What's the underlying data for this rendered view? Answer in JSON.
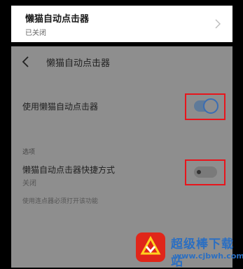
{
  "top_card": {
    "title": "懒猫自动点击器",
    "status": "已关闭",
    "chevron_icon": "chevron-right-icon"
  },
  "panel": {
    "back_icon": "back-arrow-icon",
    "title": "懒猫自动点击器",
    "row_enable": {
      "label": "使用懒猫自动点击器",
      "enabled": true
    },
    "section_label": "选项",
    "row_shortcut": {
      "label": "懒猫自动点击器快捷方式",
      "status": "关闭",
      "enabled": false
    },
    "hint": "使用连点器必须打开该功能"
  },
  "colors": {
    "highlight_border": "#e8151c",
    "toggle_accent": "#3a6db3",
    "panel_bg": "#8e8e8e",
    "watermark_blue": "#2b6fc2",
    "watermark_red": "#e0261a"
  },
  "watermark": {
    "name": "超级棒下载站",
    "url": "www.cjbwh.com"
  }
}
